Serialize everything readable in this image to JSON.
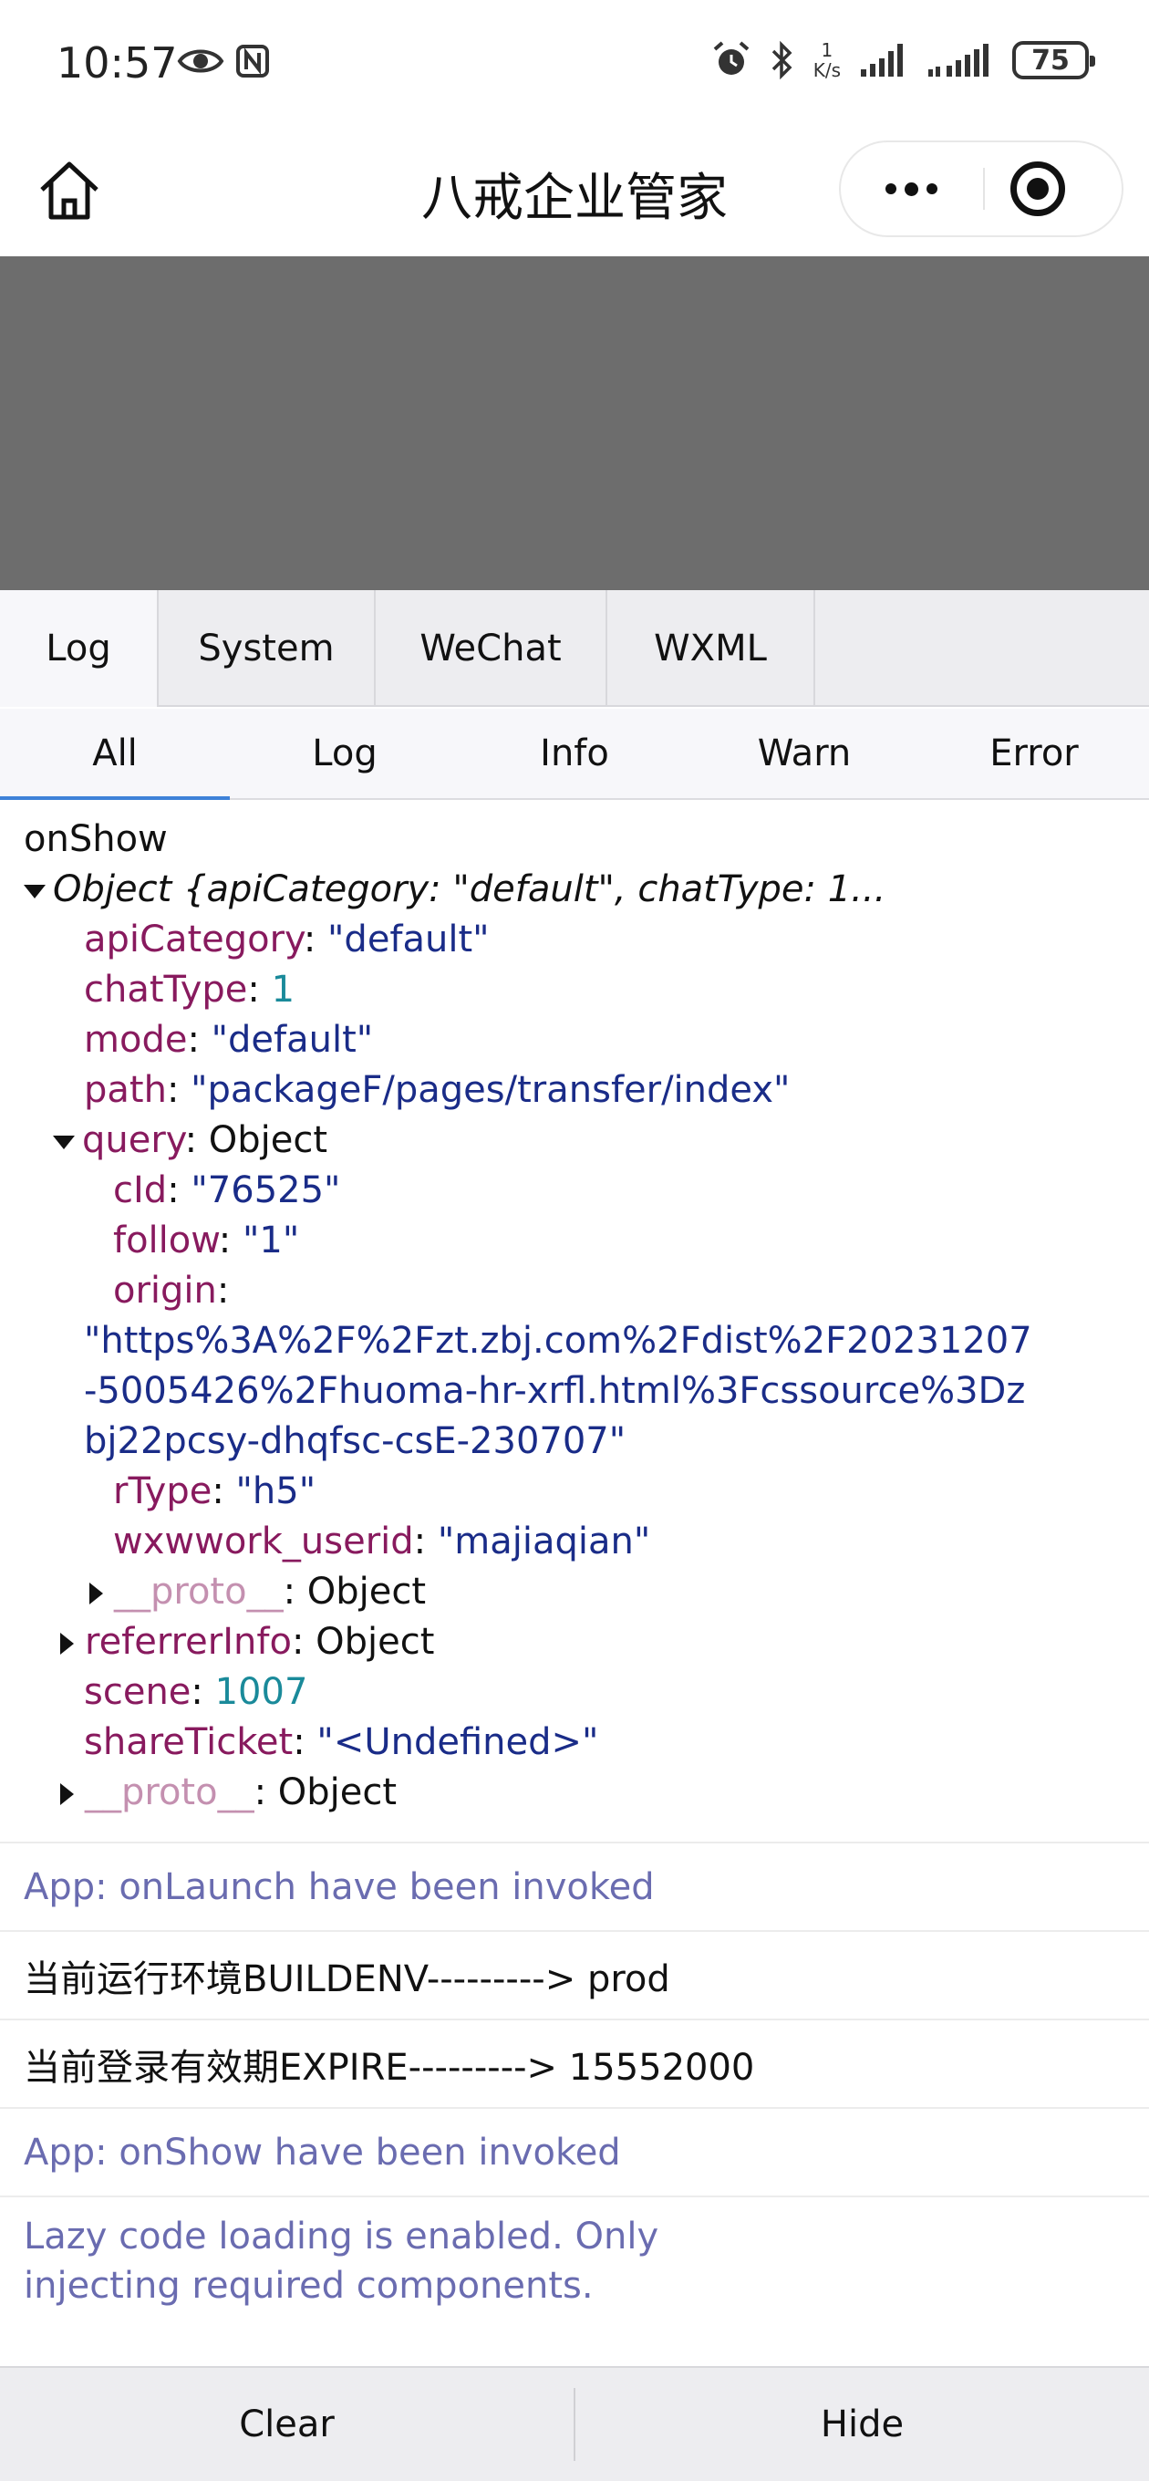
{
  "status_bar": {
    "time": "10:57",
    "left_icons": [
      "eye-icon",
      "nfc-icon"
    ],
    "right_icons": [
      "alarm-icon",
      "bluetooth-icon",
      "cell-signal-icon",
      "cell-signal-2-icon"
    ],
    "net_speed_value": "1",
    "net_speed_unit": "K/s",
    "battery": "75"
  },
  "nav": {
    "title": "八戒企业管家",
    "home_icon": "home-icon",
    "more_icon": "more-dots-icon",
    "close_icon": "target-close-icon"
  },
  "panel_tabs": [
    {
      "label": "Log",
      "active": true
    },
    {
      "label": "System",
      "active": false
    },
    {
      "label": "WeChat",
      "active": false
    },
    {
      "label": "WXML",
      "active": false
    }
  ],
  "filter_tabs": [
    {
      "label": "All",
      "active": true
    },
    {
      "label": "Log",
      "active": false
    },
    {
      "label": "Info",
      "active": false
    },
    {
      "label": "Warn",
      "active": false
    },
    {
      "label": "Error",
      "active": false
    }
  ],
  "log": {
    "first_line": "onShow",
    "object_summary": "Object {apiCategory: \"default\", chatType: 1...",
    "fields": {
      "apiCategory_key": "apiCategory",
      "apiCategory_val": "\"default\"",
      "chatType_key": "chatType",
      "chatType_val": "1",
      "mode_key": "mode",
      "mode_val": "\"default\"",
      "path_key": "path",
      "path_val": "\"packageF/pages/transfer/index\"",
      "query_key": "query",
      "query_val": "Object",
      "cId_key": "cId",
      "cId_val": "\"76525\"",
      "follow_key": "follow",
      "follow_val": "\"1\"",
      "origin_key": "origin",
      "origin_val": "\"https%3A%2F%2Fzt.zbj.com%2Fdist%2F20231207-5005426%2Fhuoma-hr-xrfl.html%3Fcssource%3Dzbj22pcsy-dhqfsc-csE-230707\"",
      "rType_key": "rType",
      "rType_val": "\"h5\"",
      "userid_key": "wxwwork_userid",
      "userid_val": "\"majiaqian\"",
      "proto_key": "__proto__",
      "proto_val": "Object",
      "referrer_key": "referrerInfo",
      "referrer_val": "Object",
      "scene_key": "scene",
      "scene_val": "1007",
      "shareTicket_key": "shareTicket",
      "shareTicket_val": "\"<Undefined>\"",
      "proto2_key": "__proto__",
      "proto2_val": "Object"
    },
    "entries": [
      {
        "text": "App: onLaunch have been invoked",
        "level": "info"
      },
      {
        "text": "当前运行环境BUILDENV---------> prod",
        "level": "log"
      },
      {
        "text": "当前登录有效期EXPIRE---------> 15552000",
        "level": "log"
      },
      {
        "text": "App: onShow have been invoked",
        "level": "info"
      },
      {
        "text": "Lazy code loading is enabled. Only injecting required components.",
        "level": "info"
      }
    ]
  },
  "bottom": {
    "clear_label": "Clear",
    "hide_label": "Hide"
  },
  "colors": {
    "mask": "#6d6d6d",
    "active_tab_underline": "#3e82d8",
    "key": "#881a5e",
    "string": "#1a2c88",
    "number": "#1a8a9a",
    "info_text": "#6a6cb0"
  }
}
